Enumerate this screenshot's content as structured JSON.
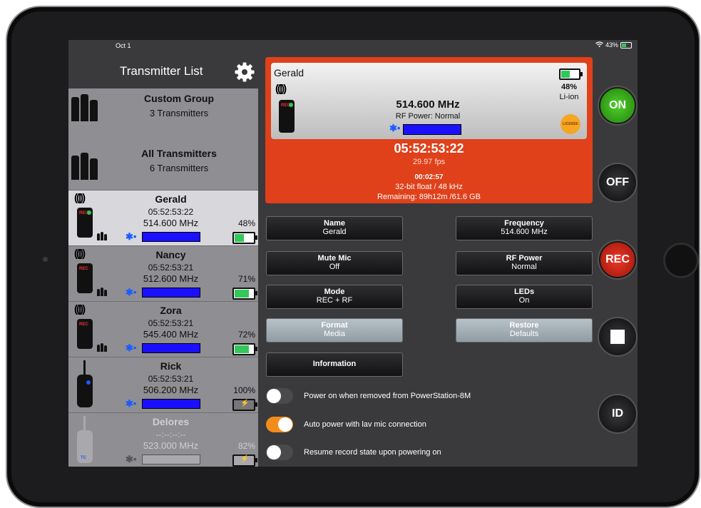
{
  "status_bar": {
    "date": "Oct 1",
    "battery": "43%"
  },
  "left": {
    "title": "Transmitter List",
    "groups": [
      {
        "name": "Custom Group",
        "count": "3 Transmitters"
      },
      {
        "name": "All Transmitters",
        "count": "6 Transmitters"
      }
    ],
    "transmitters": [
      {
        "name": "Gerald",
        "time": "05:52:53:22",
        "freq": "514.600 MHz",
        "battery": "48%",
        "battery_level": 0.48,
        "label": "REC"
      },
      {
        "name": "Nancy",
        "time": "05:52:53:21",
        "freq": "512.600 MHz",
        "battery": "71%",
        "battery_level": 0.71,
        "label": "REC"
      },
      {
        "name": "Zora",
        "time": "05:52:53:21",
        "freq": "545.400 MHz",
        "battery": "72%",
        "battery_level": 0.72,
        "label": "REC"
      },
      {
        "name": "Rick",
        "time": "05:52:53:21",
        "freq": "506.200 MHz",
        "battery": "100%",
        "battery_level": 1.0
      },
      {
        "name": "Delores",
        "time": "--:--:--:--",
        "freq": "523.000 MHz",
        "battery": "82%",
        "battery_level": 0.82,
        "label": "TC"
      }
    ]
  },
  "detail": {
    "name": "Gerald",
    "freq": "514.600 MHz",
    "rf_power": "RF Power: Normal",
    "battery_pct": "48%",
    "battery_type": "Li-ion",
    "license": "LICENSE",
    "device_label": "REC",
    "timecode": "05:52:53:22",
    "fps": "29.97 fps",
    "duration": "00:02:57",
    "format": "32-bit float / 48 kHz",
    "remaining": "Remaining: 89h12m /61.6 GB"
  },
  "settings": {
    "name": {
      "label": "Name",
      "value": "Gerald"
    },
    "frequency": {
      "label": "Frequency",
      "value": "514.600 MHz"
    },
    "mute_mic": {
      "label": "Mute Mic",
      "value": "Off"
    },
    "rf_power": {
      "label": "RF Power",
      "value": "Normal"
    },
    "mode": {
      "label": "Mode",
      "value": "REC + RF"
    },
    "leds": {
      "label": "LEDs",
      "value": "On"
    },
    "format": {
      "label": "Format",
      "value": "Media"
    },
    "restore": {
      "label": "Restore",
      "value": "Defaults"
    },
    "information": {
      "label": "Information"
    }
  },
  "toggles": [
    {
      "label": "Power on when removed from PowerStation-8M",
      "on": false
    },
    {
      "label": "Auto power with lav mic connection",
      "on": true
    },
    {
      "label": "Resume record state upon powering on",
      "on": false
    }
  ],
  "side_buttons": {
    "on": "ON",
    "off": "OFF",
    "rec": "REC",
    "id": "ID"
  },
  "colors": {
    "accent_red": "#e0401a",
    "on_green": "#34c759",
    "toggle_on": "#f28c1c",
    "meter_blue": "#1a10ff"
  }
}
